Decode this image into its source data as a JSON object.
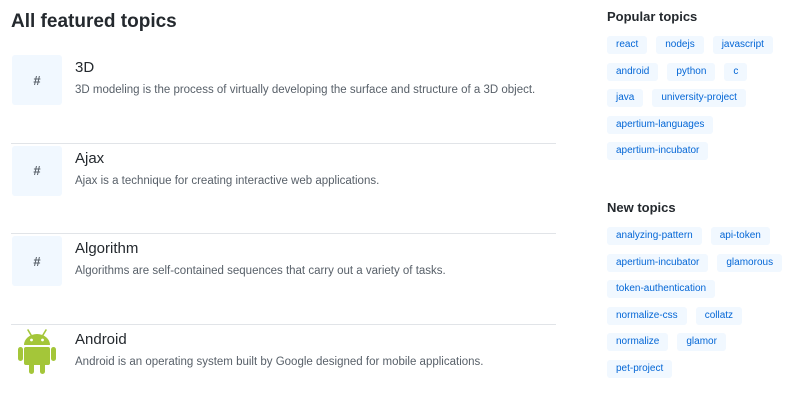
{
  "main": {
    "title": "All featured topics",
    "topics": [
      {
        "thumb": "#",
        "name": "3D",
        "description": "3D modeling is the process of virtually developing the surface and structure of a 3D object."
      },
      {
        "thumb": "#",
        "name": "Ajax",
        "description": "Ajax is a technique for creating interactive web applications."
      },
      {
        "thumb": "#",
        "name": "Algorithm",
        "description": "Algorithms are self-contained sequences that carry out a variety of tasks."
      },
      {
        "thumb_icon": "android-logo-icon",
        "name": "Android",
        "description": "Android is an operating system built by Google designed for mobile applications."
      }
    ]
  },
  "sidebar": {
    "popular": {
      "heading": "Popular topics",
      "tags": [
        "react",
        "nodejs",
        "javascript",
        "android",
        "python",
        "c",
        "java",
        "university-project",
        "apertium-languages",
        "apertium-incubator"
      ]
    },
    "new": {
      "heading": "New topics",
      "tags": [
        "analyzing-pattern",
        "api-token",
        "apertium-incubator",
        "glamorous",
        "token-authentication",
        "normalize-css",
        "collatz",
        "normalize",
        "glamor",
        "pet-project"
      ]
    }
  },
  "colors": {
    "link": "#0366d6",
    "tag_bg": "#f1f8ff",
    "android_green": "#a4c639",
    "divider": "#e1e4e8"
  }
}
